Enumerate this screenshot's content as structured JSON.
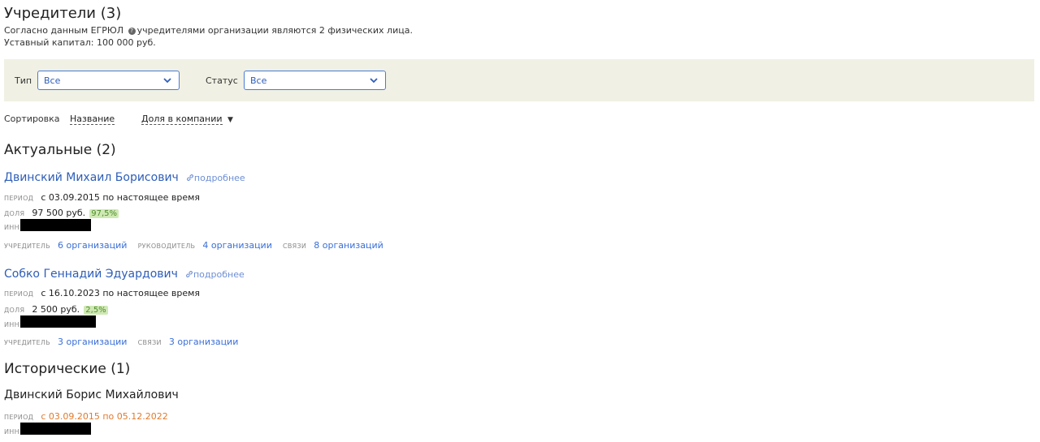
{
  "header": {
    "title": "Учредители (3)",
    "egrul_prefix": "Согласно данным ЕГРЮЛ",
    "egrul_suffix": "учредителями организации являются 2 физических лица.",
    "capital": "Уставный капитал: 100 000 руб."
  },
  "filters": {
    "type_label": "Тип",
    "type_value": "Все",
    "status_label": "Статус",
    "status_value": "Все"
  },
  "sort": {
    "label": "Сортировка",
    "by_name": "Название",
    "by_share": "Доля в компании",
    "arrow": "▼"
  },
  "labels": {
    "period": "период",
    "share": "доля",
    "inn": "инн",
    "founder": "учредитель",
    "director": "руководитель",
    "links": "связи",
    "more": "подробнее"
  },
  "actual": {
    "title": "Актуальные (2)",
    "items": [
      {
        "name": "Двинский Михаил Борисович",
        "period": "с 03.09.2015 по настоящее время",
        "share_amount": "97 500 руб.",
        "share_pct": "97,5%",
        "founder_count": "6 организаций",
        "director_count": "4 организации",
        "links_count": "8 организаций"
      },
      {
        "name": "Собко Геннадий Эдуардович",
        "period": "с 16.10.2023 по настоящее время",
        "share_amount": "2 500 руб.",
        "share_pct": "2,5%",
        "founder_count": "3 организации",
        "links_count": "3 организации"
      }
    ]
  },
  "historical": {
    "title": "Исторические (1)",
    "items": [
      {
        "name": "Двинский Борис Михайлович",
        "period": "с 03.09.2015 по 05.12.2022"
      }
    ]
  },
  "colors": {
    "link": "#2e5eb8",
    "filter_bg": "#f0f0e4",
    "pct_bg": "#cfe9b4",
    "historical_period": "#e07a2c"
  }
}
